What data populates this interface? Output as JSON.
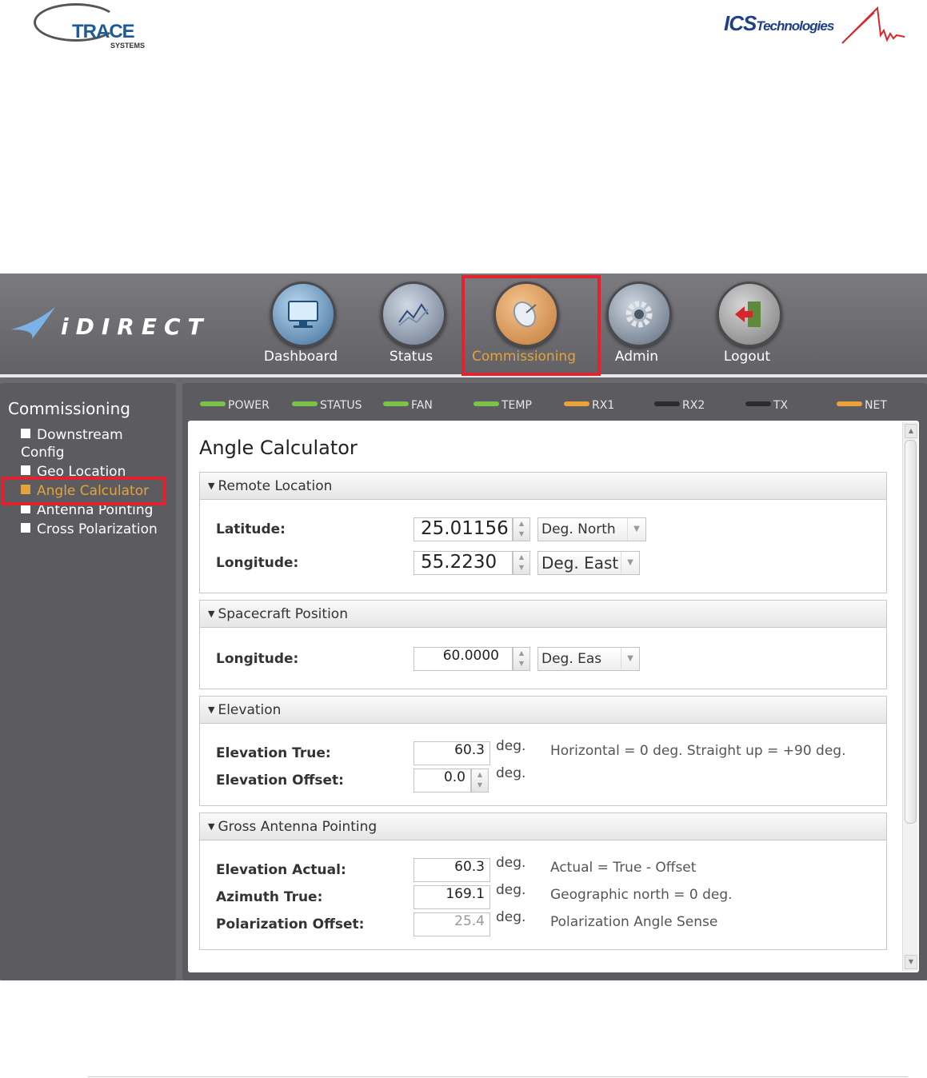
{
  "doc_header": {
    "left_logo": {
      "word": "TRACE",
      "sub": "SYSTEMS"
    },
    "right_logo": {
      "word": "ICS",
      "suffix": "Technologies"
    }
  },
  "app": {
    "brand": "iDIRECT",
    "nav": [
      {
        "label": "Dashboard",
        "icon": "monitor-icon"
      },
      {
        "label": "Status",
        "icon": "chart-icon"
      },
      {
        "label": "Commissioning",
        "icon": "satellite-dish-icon",
        "active": true
      },
      {
        "label": "Admin",
        "icon": "gear-icon"
      },
      {
        "label": "Logout",
        "icon": "logout-icon"
      }
    ],
    "sidebar": {
      "title": "Commissioning",
      "items": [
        {
          "label": "Downstream Config"
        },
        {
          "label": "Geo Location"
        },
        {
          "label": "Angle Calculator",
          "active": true
        },
        {
          "label": "Antenna Pointing"
        },
        {
          "label": "Cross Polarization"
        }
      ]
    },
    "status_leds": [
      {
        "label": "POWER",
        "color": "#7cc24a"
      },
      {
        "label": "STATUS",
        "color": "#7cc24a"
      },
      {
        "label": "FAN",
        "color": "#7cc24a"
      },
      {
        "label": "TEMP",
        "color": "#7cc24a"
      },
      {
        "label": "RX1",
        "color": "#e8a33c"
      },
      {
        "label": "RX2",
        "color": "#2b2b2b"
      },
      {
        "label": "TX",
        "color": "#2b2b2b"
      },
      {
        "label": "NET",
        "color": "#e8a33c"
      }
    ],
    "page_title": "Angle Calculator",
    "remote_location": {
      "title": "Remote Location",
      "latitude_label": "Latitude:",
      "latitude_value": "25.01156",
      "latitude_unit": "Deg. North",
      "longitude_label": "Longitude:",
      "longitude_value": "55.2230",
      "longitude_unit": "Deg. East"
    },
    "spacecraft": {
      "title": "Spacecraft Position",
      "longitude_label": "Longitude:",
      "longitude_value": "60.0000",
      "longitude_unit": "Deg. Eas"
    },
    "elevation": {
      "title": "Elevation",
      "true_label": "Elevation True:",
      "true_value": "60.3",
      "offset_label": "Elevation Offset:",
      "offset_value": "0.0",
      "unit": "deg.",
      "hint": "Horizontal = 0 deg. Straight up = +90 deg."
    },
    "gross_pointing": {
      "title": "Gross Antenna Pointing",
      "elev_actual_label": "Elevation Actual:",
      "elev_actual_value": "60.3",
      "elev_actual_hint": "Actual = True - Offset",
      "azimuth_label": "Azimuth True:",
      "azimuth_value": "169.1",
      "azimuth_hint": "Geographic north = 0 deg.",
      "polarization_label": "Polarization Offset:",
      "polarization_value": "25.4",
      "polarization_hint": "Polarization Angle Sense",
      "unit": "deg."
    },
    "accent_color": "#e3a23b",
    "highlight_color": "#e0232e"
  }
}
